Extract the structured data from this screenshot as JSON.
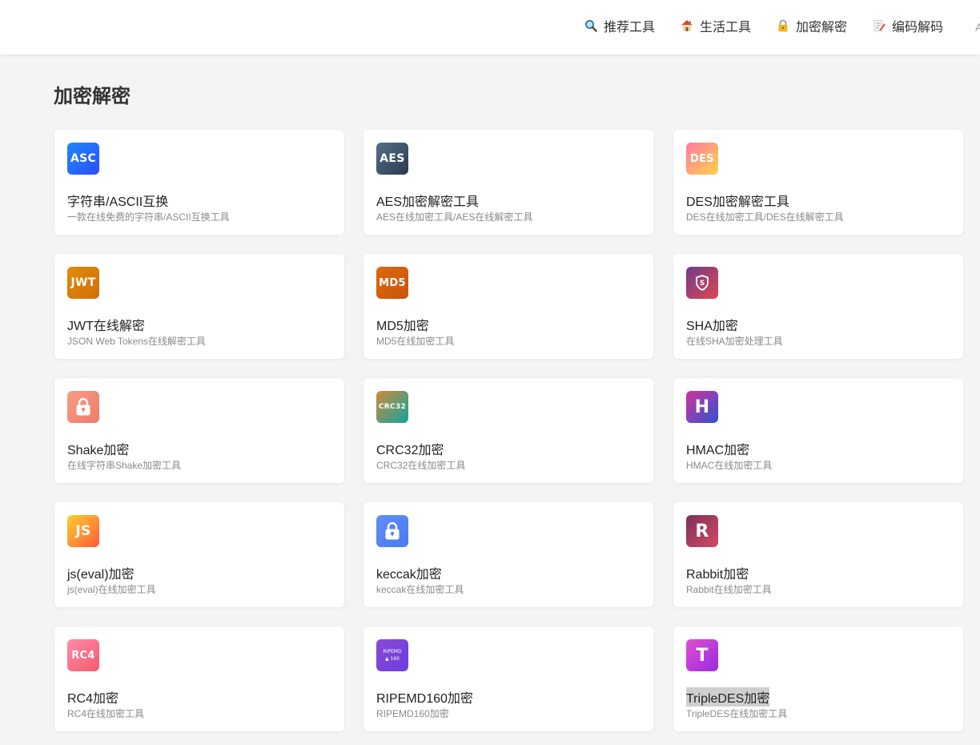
{
  "nav": [
    {
      "label": "推荐工具",
      "icon": "magnifier-icon"
    },
    {
      "label": "生活工具",
      "icon": "house-icon"
    },
    {
      "label": "加密解密",
      "icon": "lock-icon"
    },
    {
      "label": "编码解码",
      "icon": "memo-icon"
    }
  ],
  "page": {
    "title": "加密解密"
  },
  "cards": [
    {
      "icon_text": "ASC",
      "title": "字符串/ASCII互换",
      "desc": "一款在线免费的字符串/ASCII互换工具",
      "icon": "asc-icon",
      "colors": [
        "#1e88ff",
        "#2d4dff"
      ]
    },
    {
      "icon_text": "AES",
      "title": "AES加密解密工具",
      "desc": "AES在线加密工具/AES在线解密工具",
      "icon": "aes-icon",
      "colors": [
        "#56708a",
        "#2b3a4c"
      ]
    },
    {
      "icon_text": "DES",
      "title": "DES加密解密工具",
      "desc": "DES在线加密工具/DES在线解密工具",
      "icon": "des-icon",
      "colors": [
        "#ff7aa0",
        "#ffd24a"
      ]
    },
    {
      "icon_text": "JWT",
      "title": "JWT在线解密",
      "desc": "JSON Web Tokens在线解密工具",
      "icon": "jwt-icon",
      "colors": [
        "#e38a09",
        "#d0700a"
      ]
    },
    {
      "icon_text": "MD5",
      "title": "MD5加密",
      "desc": "MD5在线加密工具",
      "icon": "md5-icon",
      "colors": [
        "#db6a0c",
        "#c9540c"
      ]
    },
    {
      "icon_text": "S",
      "title": "SHA加密",
      "desc": "在线SHA加密处理工具",
      "icon": "shield-icon",
      "colors": [
        "#6d3b8f",
        "#e0474c"
      ]
    },
    {
      "icon_text": "",
      "title": "Shake加密",
      "desc": "在线字符串Shake加密工具",
      "icon": "padlock-icon",
      "colors": [
        "#f59d84",
        "#f07a6a"
      ]
    },
    {
      "icon_text": "CRC32",
      "title": "CRC32加密",
      "desc": "CRC32在线加密工具",
      "icon": "crc32-icon",
      "colors": [
        "#d08a3a",
        "#10a59d"
      ]
    },
    {
      "icon_text": "H",
      "title": "HMAC加密",
      "desc": "HMAC在线加密工具",
      "icon": "hmac-icon",
      "colors": [
        "#d1349a",
        "#2d52d3"
      ]
    },
    {
      "icon_text": "JS",
      "title": "js(eval)加密",
      "desc": "js(eval)在线加密工具",
      "icon": "js-icon",
      "colors": [
        "#ffd02a",
        "#ff5a3c"
      ]
    },
    {
      "icon_text": "",
      "title": "keccak加密",
      "desc": "keccak在线加密工具",
      "icon": "padlock-icon",
      "colors": [
        "#5f8ff5",
        "#4a7bf0"
      ]
    },
    {
      "icon_text": "R",
      "title": "Rabbit加密",
      "desc": "Rabbit在线加密工具",
      "icon": "rabbit-icon",
      "colors": [
        "#7d2f5d",
        "#d14b60"
      ]
    },
    {
      "icon_text": "RC4",
      "title": "RC4加密",
      "desc": "RC4在线加密工具",
      "icon": "rc4-icon",
      "colors": [
        "#ff8bab",
        "#f45b6c"
      ]
    },
    {
      "icon_text": "RIPEMD",
      "icon_sub": "▲ 160",
      "title": "RIPEMD160加密",
      "desc": "RIPEMD160加密",
      "icon": "ripemd-icon",
      "colors": [
        "#8a4ad6",
        "#6a3ee0"
      ]
    },
    {
      "icon_text": "T",
      "title": "TripleDES加密",
      "desc": "TripleDES在线加密工具",
      "icon": "tripledes-icon",
      "colors": [
        "#e04fcf",
        "#9b2be0"
      ],
      "highlight": true
    }
  ]
}
